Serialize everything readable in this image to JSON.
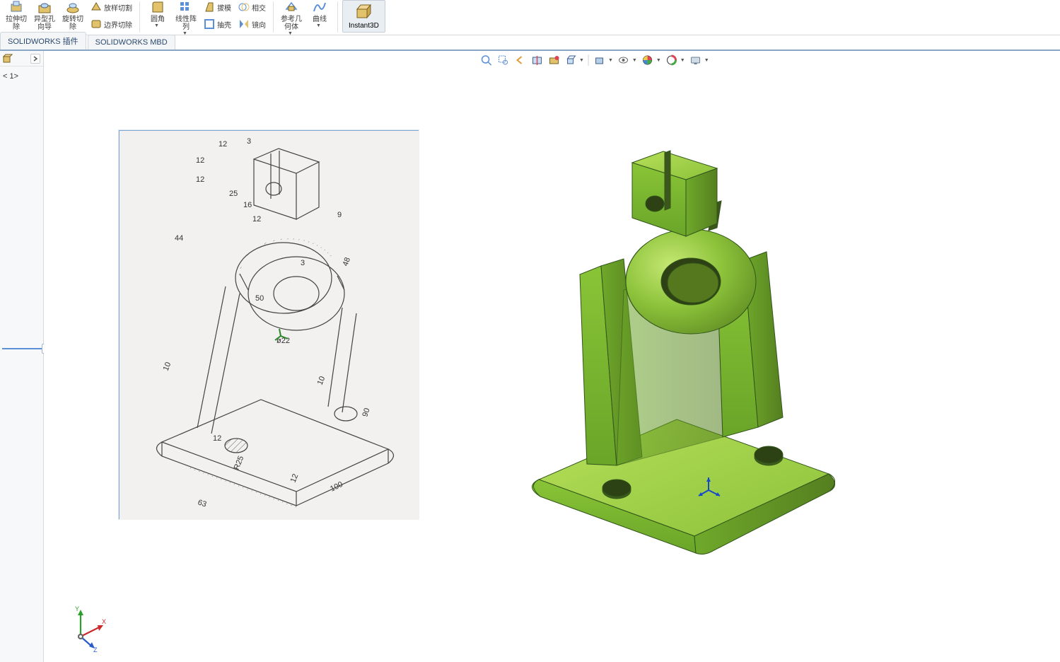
{
  "ribbon": {
    "extrude_cut": "拉伸切\n除",
    "hole_wizard": "异型孔\n向导",
    "revolve_cut": "旋转切\n除",
    "lofted_cut": "放样切割",
    "boundary_cut": "边界切除",
    "fillet": "圆角",
    "linear_pattern": "线性阵\n列",
    "draft": "拔模",
    "shell": "抽壳",
    "intersect": "相交",
    "mirror": "镜向",
    "ref_geom": "参考几\n何体",
    "curve": "曲线",
    "instant3d": "Instant3D"
  },
  "tabs": {
    "addins": "SOLIDWORKS 插件",
    "mbd": "SOLIDWORKS MBD"
  },
  "tree": {
    "default_display": "< 1>"
  },
  "sketch_annotations": {
    "d12a": "12",
    "d12b": "12",
    "d12c": "12",
    "d3": "3",
    "d16": "16",
    "d25": "25",
    "d12d": "12",
    "d50": "50",
    "dphi22": "ø22",
    "d44": "44",
    "d48": "48",
    "d9": "9",
    "d3b": "3",
    "d10a": "10",
    "d10b": "10",
    "d12e": "12",
    "r25": "R25",
    "d12f": "12",
    "d63": "63",
    "d100": "100",
    "d90": "90"
  }
}
